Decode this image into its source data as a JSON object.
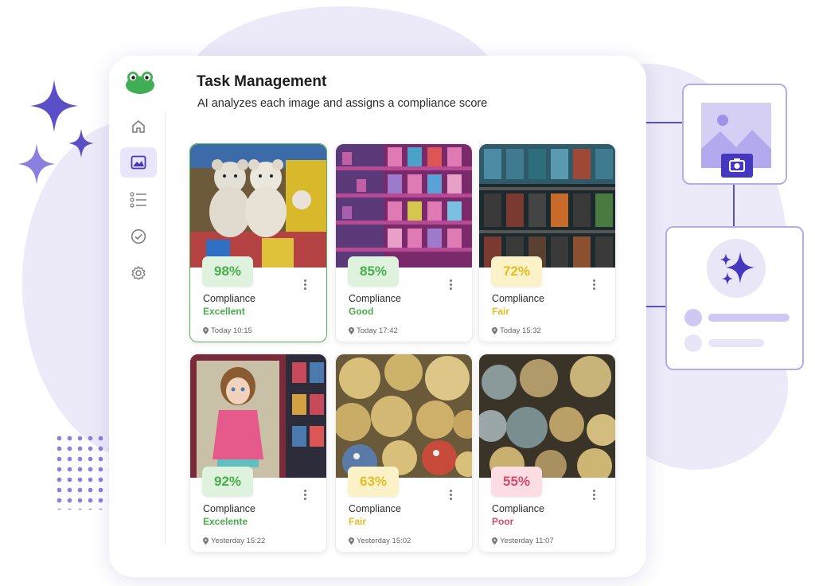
{
  "app": {
    "title": "Task Management",
    "subtitle": "AI analyzes each image and assigns a compliance score"
  },
  "sidebar": {
    "items": [
      {
        "name": "home",
        "icon": "home-icon",
        "active": false
      },
      {
        "name": "images",
        "icon": "image-icon",
        "active": true
      },
      {
        "name": "list",
        "icon": "list-icon",
        "active": false
      },
      {
        "name": "tasks",
        "icon": "check-circle-icon",
        "active": false
      },
      {
        "name": "settings",
        "icon": "gear-icon",
        "active": false
      }
    ]
  },
  "cards": [
    {
      "score": "98%",
      "label": "Compliance",
      "status": "Excellent",
      "time": "Today 10:15",
      "tone": "green"
    },
    {
      "score": "85%",
      "label": "Compliance",
      "status": "Good",
      "time": "Today 17:42",
      "tone": "green"
    },
    {
      "score": "72%",
      "label": "Compliance",
      "status": "Fair",
      "time": "Today 15:32",
      "tone": "yellow"
    },
    {
      "score": "92%",
      "label": "Compliance",
      "status": "Excelente",
      "time": "Yesterday 15:22",
      "tone": "green"
    },
    {
      "score": "63%",
      "label": "Compliance",
      "status": "Fair",
      "time": "Yesterday 15:02",
      "tone": "yellow"
    },
    {
      "score": "55%",
      "label": "Compliance",
      "status": "Poor",
      "time": "Yesterday 11:07",
      "tone": "red"
    }
  ],
  "colors": {
    "accent": "#5b4fc7",
    "active_nav": "#e9e6fb",
    "green": "#48ad4b",
    "yellow": "#e3bd21",
    "red": "#d44a6a",
    "background_blob": "#eceaf8"
  }
}
